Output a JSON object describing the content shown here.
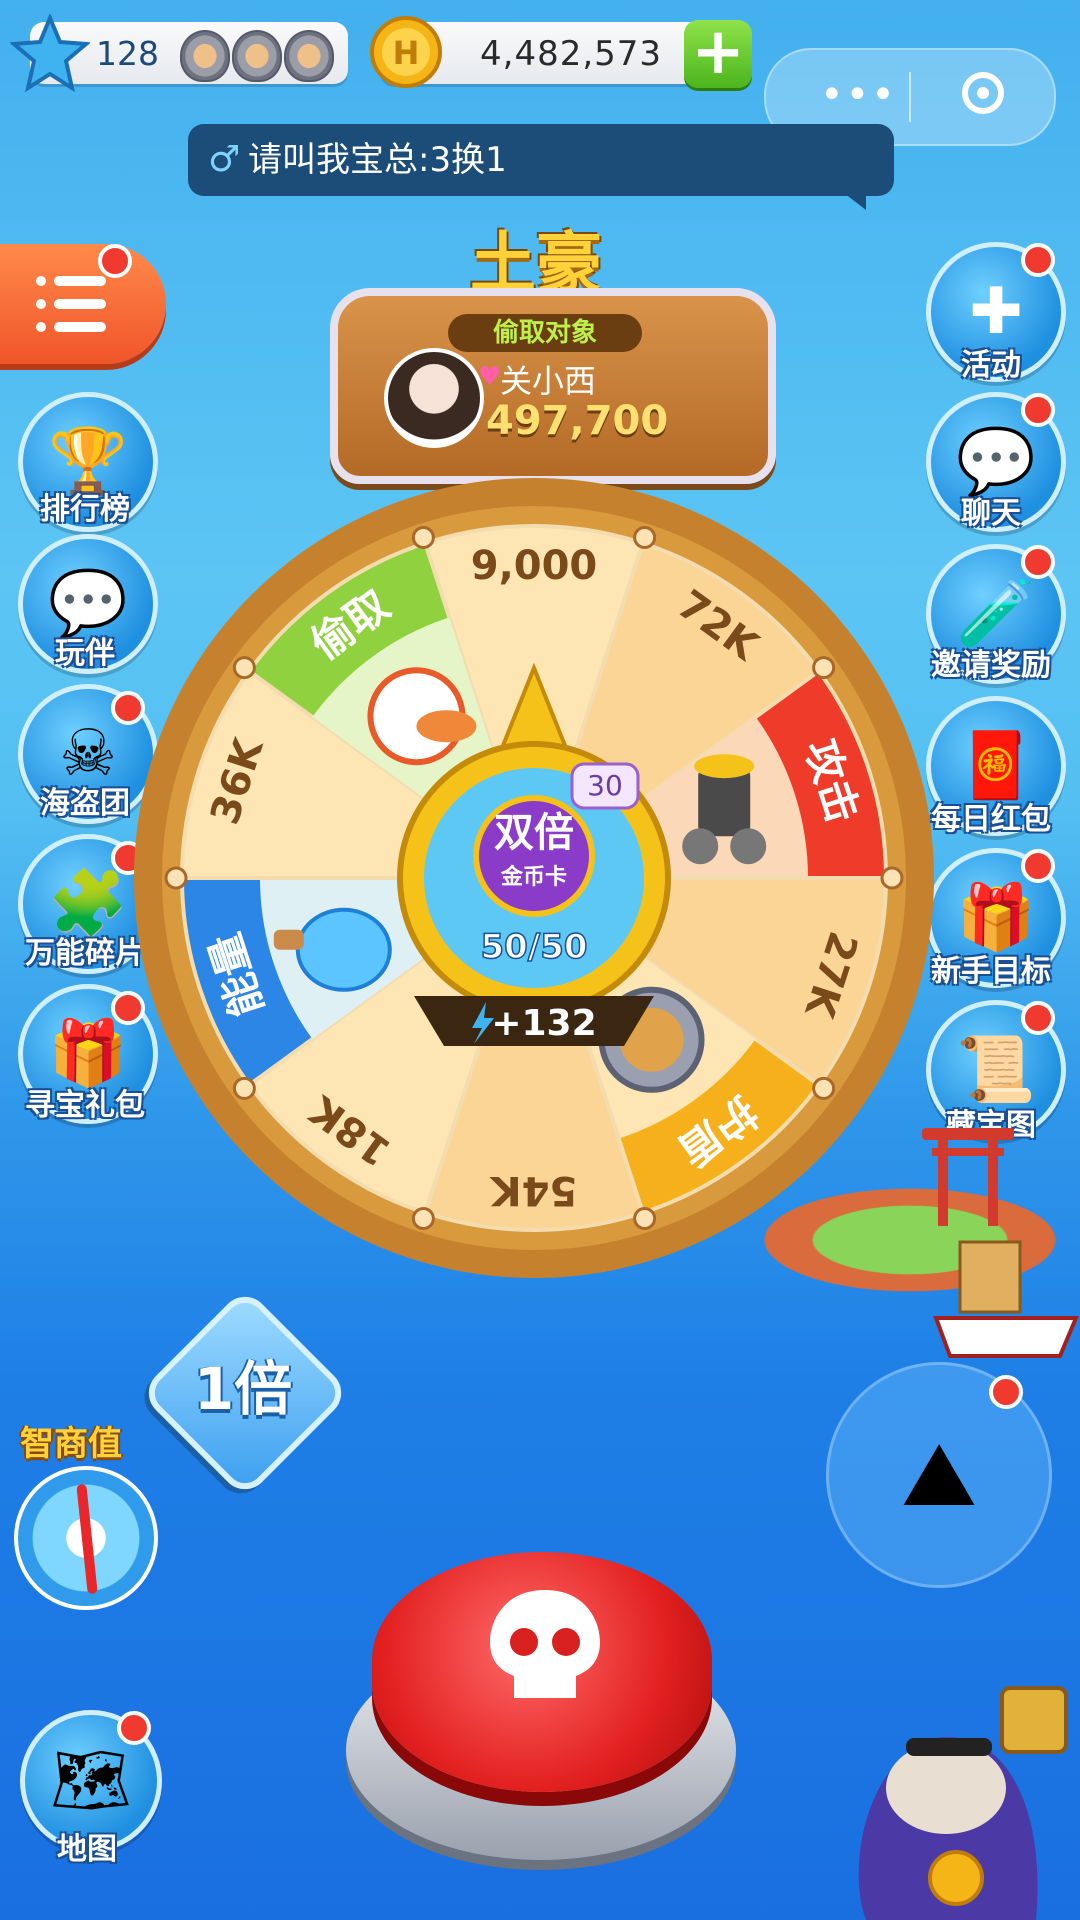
{
  "top_bar": {
    "stars": "128",
    "coins": "4,482,573",
    "plus_symbol": "+"
  },
  "chat_bubble": {
    "gender_symbol": "♂",
    "message": "请叫我宝总:3换1"
  },
  "plaque": {
    "title": "土豪",
    "tag": "偷取对象",
    "player_name": "关小西",
    "player_coins": "497,700"
  },
  "left_menu": [
    {
      "label": "排行榜",
      "icon": "trophy-icon"
    },
    {
      "label": "玩伴",
      "icon": "chat-buddy-icon"
    },
    {
      "label": "海盗团",
      "icon": "pirate-crew-icon"
    },
    {
      "label": "万能碎片",
      "icon": "puzzle-piece-icon"
    },
    {
      "label": "寻宝礼包",
      "icon": "treasure-chest-icon"
    }
  ],
  "right_menu": [
    {
      "label": "活动",
      "icon": "bone-cross-icon"
    },
    {
      "label": "聊天",
      "icon": "chat-bubbles-icon"
    },
    {
      "label": "邀请奖励",
      "icon": "potion-bottle-icon"
    },
    {
      "label": "每日红包",
      "icon": "red-envelope-icon"
    },
    {
      "label": "新手目标",
      "icon": "gift-box-icon"
    },
    {
      "label": "藏宝图",
      "icon": "scroll-icon"
    }
  ],
  "wheel": {
    "segments": [
      {
        "label": "9,000",
        "type": "coins"
      },
      {
        "label": "72K",
        "type": "coins"
      },
      {
        "label": "攻击",
        "type": "attack"
      },
      {
        "label": "27K",
        "type": "coins"
      },
      {
        "label": "护盾",
        "type": "shield"
      },
      {
        "label": "54K",
        "type": "coins"
      },
      {
        "label": "18K",
        "type": "coins"
      },
      {
        "label": "能量",
        "type": "energy"
      },
      {
        "label": "36K",
        "type": "coins"
      },
      {
        "label": "偷取",
        "type": "steal"
      }
    ],
    "center": {
      "card_title": "双倍",
      "card_subtitle": "金币卡",
      "card_count": "30",
      "energy": "50/50",
      "energy_bonus": "+132"
    }
  },
  "multiplier": "1倍",
  "iq_label": "智商值",
  "map_label": "地图",
  "colors": {
    "steal": "#8fd13f",
    "attack": "#ef3c2a",
    "shield": "#f6b01c",
    "energy": "#2b86e6",
    "coin_light": "#fde6b4",
    "coin_dark": "#fbd595",
    "rim": "#d89a3c"
  }
}
